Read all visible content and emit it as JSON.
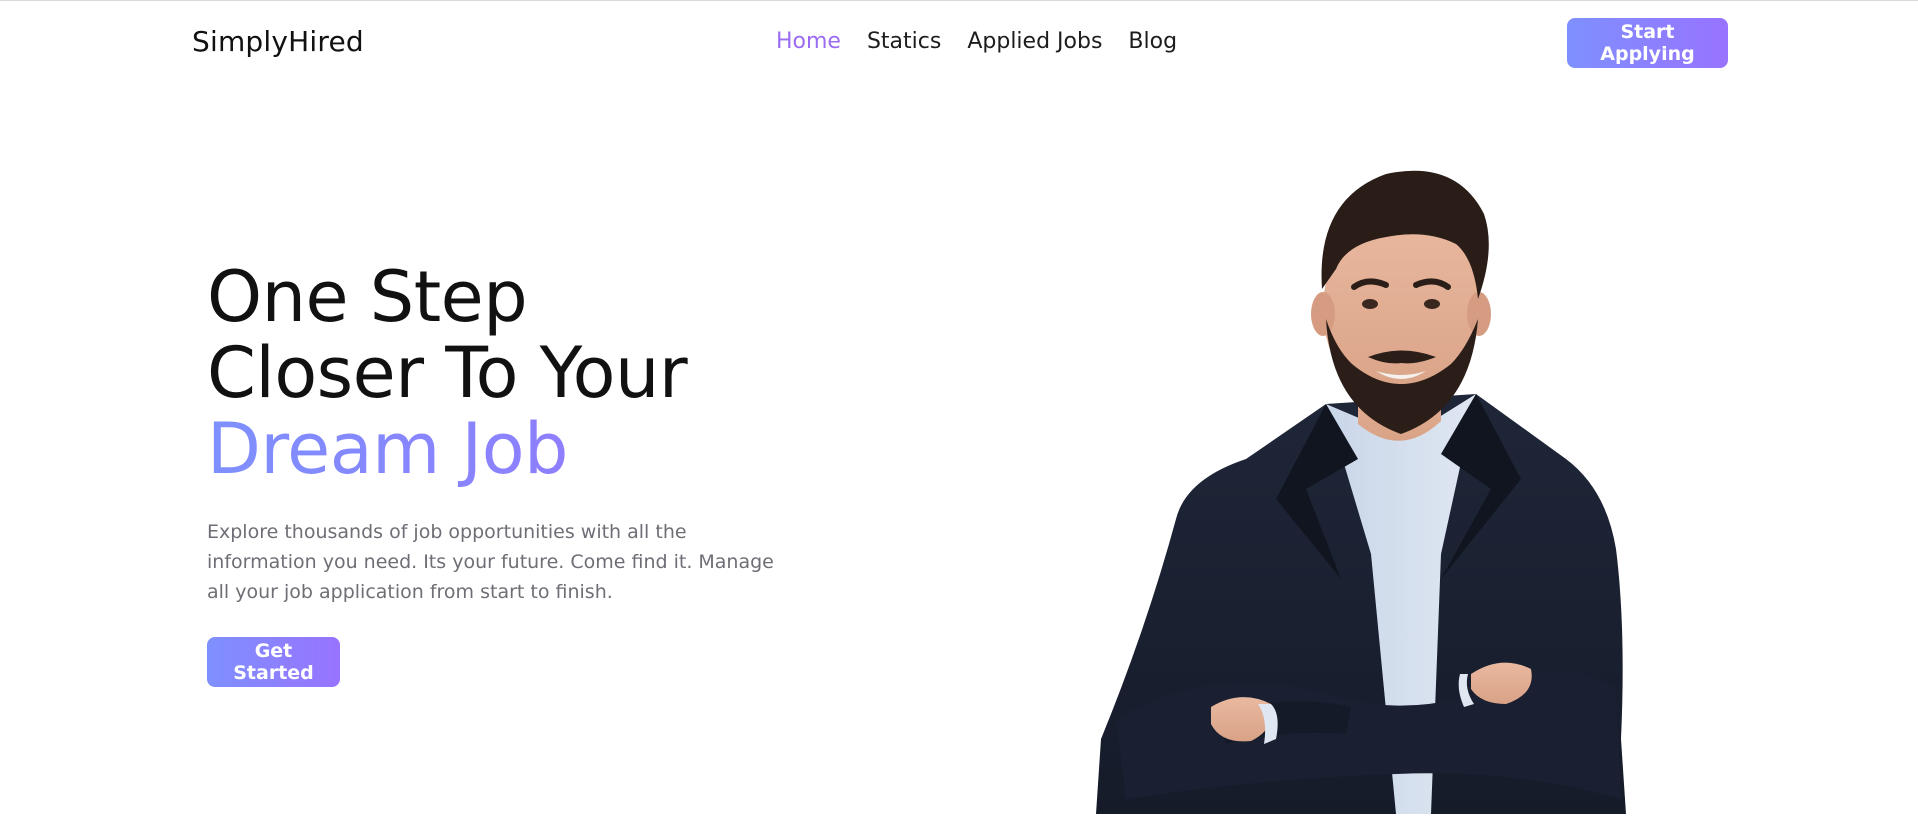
{
  "nav": {
    "brand": "SimplyHired",
    "links": [
      {
        "label": "Home",
        "active": true
      },
      {
        "label": "Statics",
        "active": false
      },
      {
        "label": "Applied Jobs",
        "active": false
      },
      {
        "label": "Blog",
        "active": false
      }
    ],
    "cta_label": "Start Applying"
  },
  "hero": {
    "title_line1": "One Step",
    "title_line2": "Closer To Your",
    "title_accent": "Dream Job",
    "description": "Explore thousands of job opportunities with all the information you need. Its your future. Come find it. Manage all your job application from start to finish.",
    "button_label": "Get Started",
    "image_alt": "Smiling man with beard in dark navy blazer and light blue shirt, arms crossed"
  },
  "colors": {
    "accent": "#9873ff",
    "accent_start": "#7e90fe",
    "text_dark": "#111111",
    "text_muted": "#6e6e76"
  }
}
